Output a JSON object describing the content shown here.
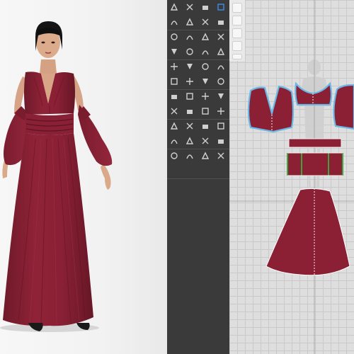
{
  "app": {
    "panels": [
      "3d-avatar-viewport",
      "tool-palette",
      "2d-pattern-window"
    ]
  },
  "garment": {
    "fabric_color": "#8b1f33",
    "fabric_shadow": "#6b1727",
    "outline_color": "#69b8e8",
    "seam_color": "#3fa33f",
    "stitch_color": "#f0f0f0"
  },
  "avatar": {
    "hair_color": "#141414",
    "skin_color": "#d9a98a",
    "shoe_color": "#1a1a1a"
  },
  "toolbox": {
    "background": "#3a3a3a",
    "icon_color": "#cfcfcf",
    "accent_color": "#3a8ee6",
    "icon_names": [
      "transform-icon",
      "edit-point-icon",
      "segment-icon",
      "select-mesh-icon",
      "polygon-icon",
      "rectangle-icon",
      "circle-icon",
      "internal-polygon-icon",
      "dart-icon",
      "curve-point-icon",
      "add-point-icon",
      "cut-icon",
      "trace-icon",
      "offset-icon",
      "rotate-icon",
      "mirror-icon",
      "sewing-icon",
      "free-sewing-icon",
      "seam-check-icon",
      "tack-icon",
      "pin-icon",
      "fold-icon",
      "arrange-icon",
      "layer-icon",
      "texture-icon",
      "graphic-icon",
      "button-icon",
      "buttonhole-icon",
      "zipper-icon",
      "elastic-icon",
      "topstitch-icon",
      "puckering-icon",
      "text-icon",
      "annotation-icon",
      "measure-icon",
      "ruler-icon",
      "trim-icon",
      "shirring-icon",
      "piping-icon",
      "avatar-icon",
      "hanger-icon",
      "fit-map-icon",
      "strain-map-icon",
      "pressure-icon"
    ]
  }
}
